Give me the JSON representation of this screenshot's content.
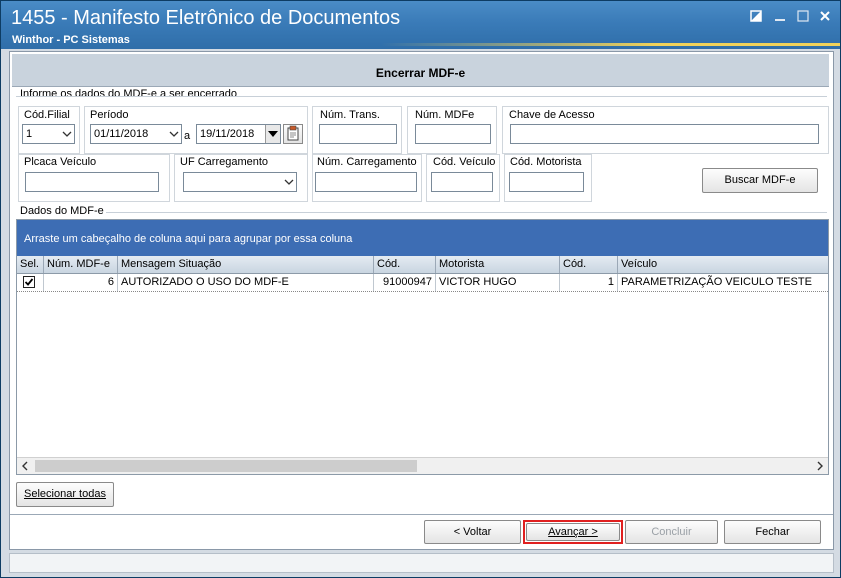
{
  "window": {
    "title": "1455 - Manifesto Eletrônico de Documentos",
    "subtitle": "Winthor - PC Sistemas"
  },
  "panel": {
    "title": "Encerrar MDF-e"
  },
  "filter": {
    "group_label": "Informe os dados do MDF-e a ser encerrado",
    "cod_filial": {
      "label": "Cód.Filial",
      "value": "1"
    },
    "periodo": {
      "label": "Período",
      "start": "01/11/2018",
      "separator": "a",
      "end": "19/11/2018"
    },
    "num_trans": {
      "label": "Núm. Trans.",
      "value": ""
    },
    "num_mdfe": {
      "label": "Núm. MDFe",
      "value": ""
    },
    "chave_acesso": {
      "label": "Chave de Acesso",
      "value": ""
    },
    "placa_veiculo": {
      "label": "Plcaca Veículo",
      "value": ""
    },
    "uf_carregamento": {
      "label": "UF Carregamento",
      "value": ""
    },
    "num_carregamento": {
      "label": "Núm. Carregamento",
      "value": ""
    },
    "cod_veiculo": {
      "label": "Cód. Veículo",
      "value": ""
    },
    "cod_motorista": {
      "label": "Cód. Motorista",
      "value": ""
    },
    "buscar_label": "Buscar MDF-e"
  },
  "grid": {
    "group_label": "Dados do MDF-e",
    "group_hint": "Arraste um cabeçalho de coluna aqui para agrupar por essa coluna",
    "columns": [
      "Sel.",
      "Núm. MDF-e",
      "Mensagem Situação",
      "Cód.",
      "Motorista",
      "Cód.",
      "Veículo"
    ],
    "rows": [
      {
        "selected": true,
        "num_mdfe": "6",
        "mensagem": "AUTORIZADO O USO DO MDF-E",
        "cod_motorista": "91000947",
        "motorista": "VICTOR HUGO",
        "cod_veiculo": "1",
        "veiculo": "PARAMETRIZAÇÃO VEICULO TESTE"
      }
    ]
  },
  "buttons": {
    "select_all": "Selecionar todas",
    "voltar": "< Voltar",
    "avancar": "Avançar >",
    "concluir": "Concluir",
    "fechar": "Fechar"
  },
  "colors": {
    "title_bar": "#3a7bb8",
    "group_bar": "#3d6db4",
    "highlight": "#e02020"
  }
}
